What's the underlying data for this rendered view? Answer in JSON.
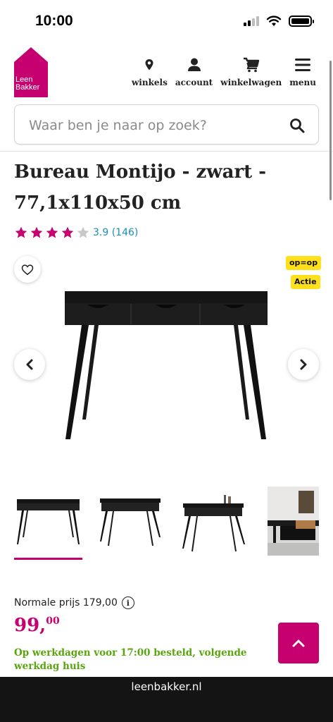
{
  "status_bar": {
    "time": "10:00"
  },
  "brand": {
    "logo_line1": "Leen",
    "logo_line2": "Bakker",
    "color": "#c6006e"
  },
  "nav": [
    {
      "label": "winkels",
      "icon": "location-pin-icon"
    },
    {
      "label": "account",
      "icon": "user-icon"
    },
    {
      "label": "winkelwagen",
      "icon": "cart-icon"
    },
    {
      "label": "menu",
      "icon": "hamburger-menu-icon"
    }
  ],
  "search": {
    "placeholder": "Waar ben je naar op zoek?"
  },
  "product": {
    "title": "Bureau Montijo - zwart - 77,1x110x50 cm",
    "rating": {
      "stars": 4,
      "max": 5,
      "text": "3.9 (146)"
    },
    "badges": [
      "op=op",
      "Actie"
    ],
    "thumbnails": 4,
    "active_thumbnail": 1
  },
  "pricing": {
    "normal_label": "Normale prijs 179,00",
    "price_main": "99,",
    "price_cents": "00"
  },
  "delivery_text": "Op werkdagen voor 17:00 besteld, volgende werkdag huis",
  "url": "leenbakker.nl",
  "colors": {
    "accent": "#c6006e",
    "badge": "#ffe01b",
    "delivery": "#5aa50f",
    "rating_link": "#1a8fb8"
  }
}
